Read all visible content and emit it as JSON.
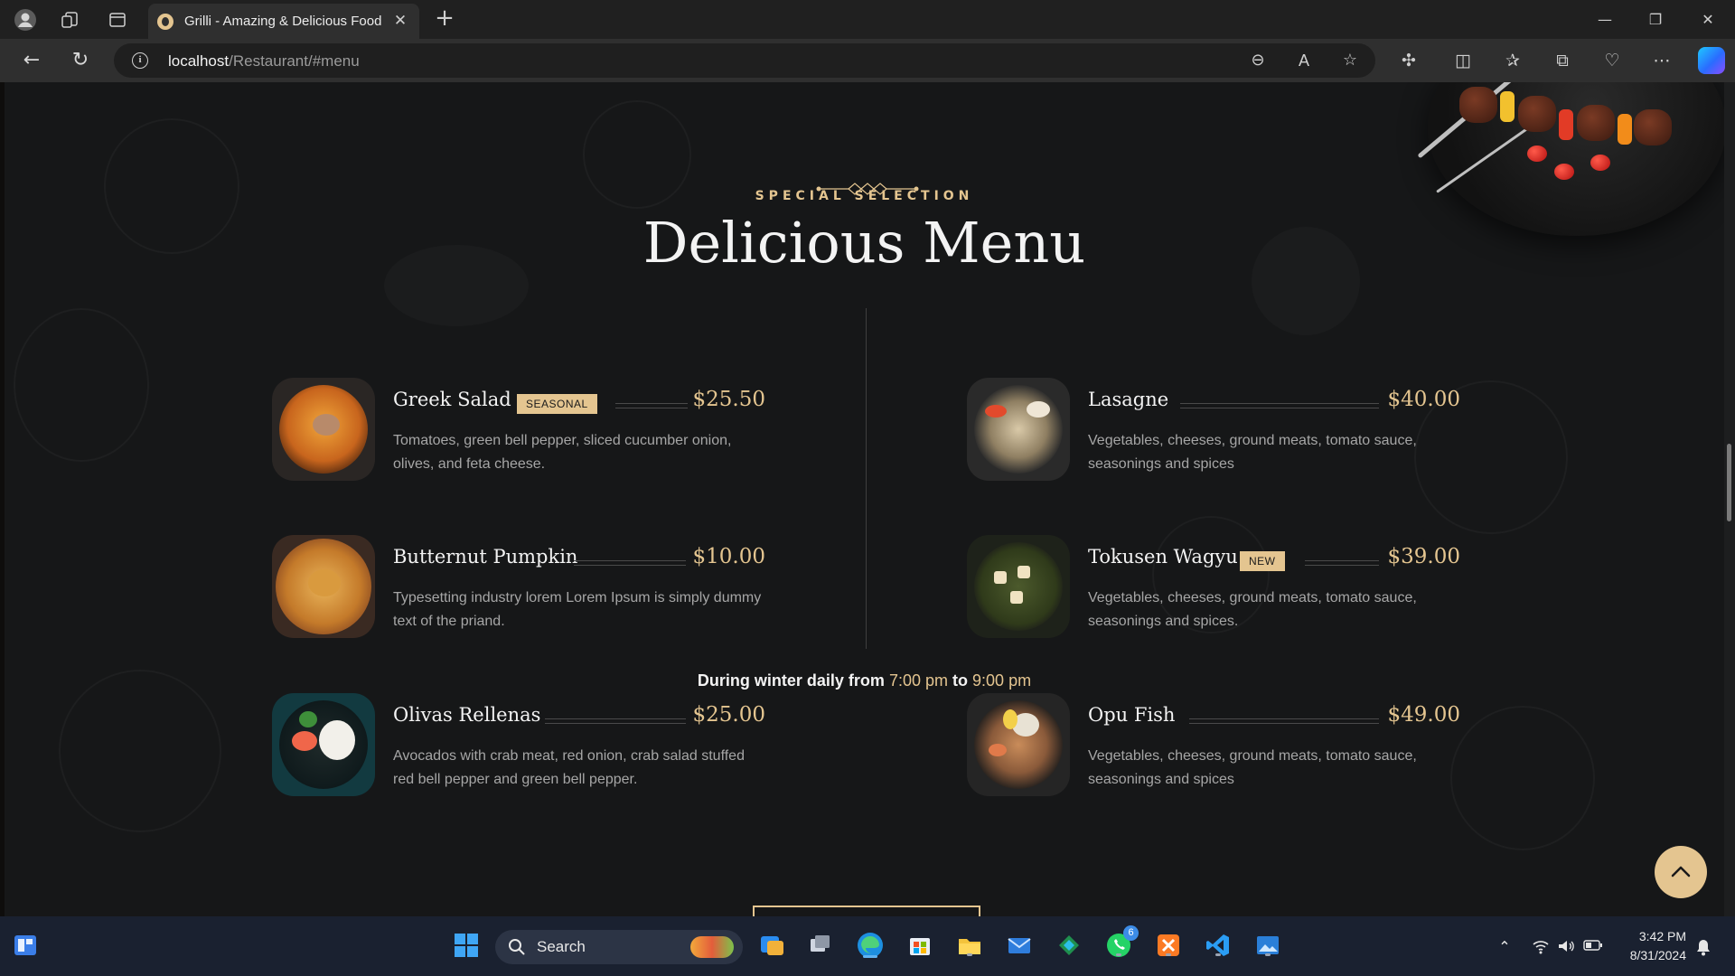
{
  "browser": {
    "tab_title": "Grilli - Amazing & Delicious Food",
    "url_host": "localhost",
    "url_path": "/Restaurant/#menu"
  },
  "page": {
    "eyebrow": "SPECIAL SELECTION",
    "title": "Delicious Menu",
    "items": [
      {
        "name": "Greek Salad",
        "badge": "SEASONAL",
        "price": "$25.50",
        "description": "Tomatoes, green bell pepper, sliced cucumber onion, olives, and feta cheese."
      },
      {
        "name": "Lasagne",
        "price": "$40.00",
        "description": "Vegetables, cheeses, ground meats, tomato sauce, seasonings and spices"
      },
      {
        "name": "Butternut Pumpkin",
        "price": "$10.00",
        "description": "Typesetting industry lorem Lorem Ipsum is simply dummy text of the priand."
      },
      {
        "name": "Tokusen Wagyu",
        "badge": "NEW",
        "price": "$39.00",
        "description": "Vegetables, cheeses, ground meats, tomato sauce, seasonings and spices."
      },
      {
        "name": "Olivas Rellenas",
        "price": "$25.00",
        "description": "Avocados with crab meat, red onion, crab salad stuffed red bell pepper and green bell pepper."
      },
      {
        "name": "Opu Fish",
        "price": "$49.00",
        "description": "Vegetables, cheeses, ground meats, tomato sauce, seasonings and spices"
      }
    ],
    "hours_prefix": "During winter daily from",
    "hours_from": "7:00 pm",
    "hours_join": "to",
    "hours_to": "9:00 pm"
  },
  "taskbar": {
    "search_label": "Search",
    "whatsapp_badge": "6",
    "time": "3:42 PM",
    "date": "8/31/2024"
  },
  "colors": {
    "accent_gold": "#e4c590",
    "background": "#161718",
    "text": "#f3f3f3"
  }
}
